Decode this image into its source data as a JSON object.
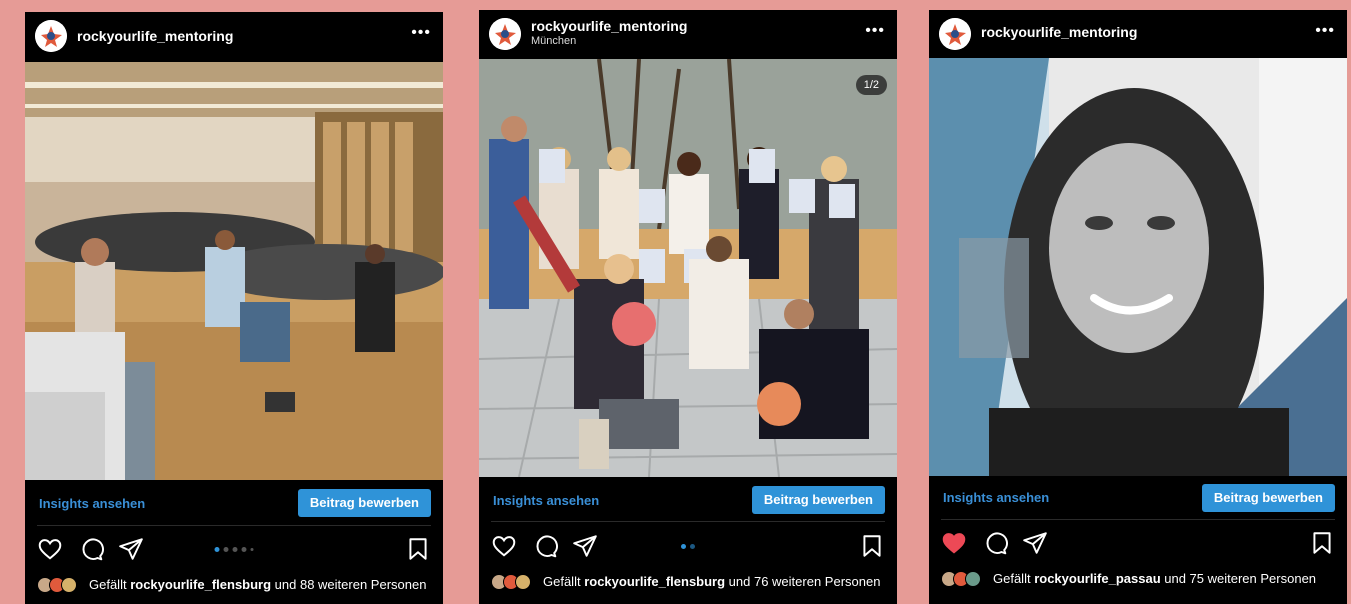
{
  "posts": [
    {
      "username": "rockyourlife_mentoring",
      "location": "",
      "more_icon": "more-dots-icon",
      "insights_label": "Insights ansehen",
      "promote_label": "Beitrag bewerben",
      "liked": false,
      "likes_prefix": "Gefällt ",
      "likes_user": "rockyourlife_flensburg",
      "likes_suffix": " und 88 weiteren Personen",
      "carousel_dots": 5,
      "carousel_active": 0,
      "image_counter": ""
    },
    {
      "username": "rockyourlife_mentoring",
      "location": "München",
      "more_icon": "more-dots-icon",
      "insights_label": "Insights ansehen",
      "promote_label": "Beitrag bewerben",
      "liked": false,
      "likes_prefix": "Gefällt ",
      "likes_user": "rockyourlife_flensburg",
      "likes_suffix": " und 76 weiteren Personen",
      "carousel_dots": 2,
      "carousel_active": 0,
      "image_counter": "1/2"
    },
    {
      "username": "rockyourlife_mentoring",
      "location": "",
      "more_icon": "more-dots-icon",
      "insights_label": "Insights ansehen",
      "promote_label": "Beitrag bewerben",
      "liked": true,
      "likes_prefix": "Gefällt ",
      "likes_user": "rockyourlife_passau",
      "likes_suffix": " und 75 weiteren Personen",
      "carousel_dots": 0,
      "carousel_active": 0,
      "image_counter": ""
    }
  ],
  "icons": {
    "like": "heart-icon",
    "comment": "comment-icon",
    "share": "paper-plane-icon",
    "save": "bookmark-icon"
  },
  "colors": {
    "background": "#e69b96",
    "accent": "#2f93d8",
    "like_active": "#ed4956"
  }
}
